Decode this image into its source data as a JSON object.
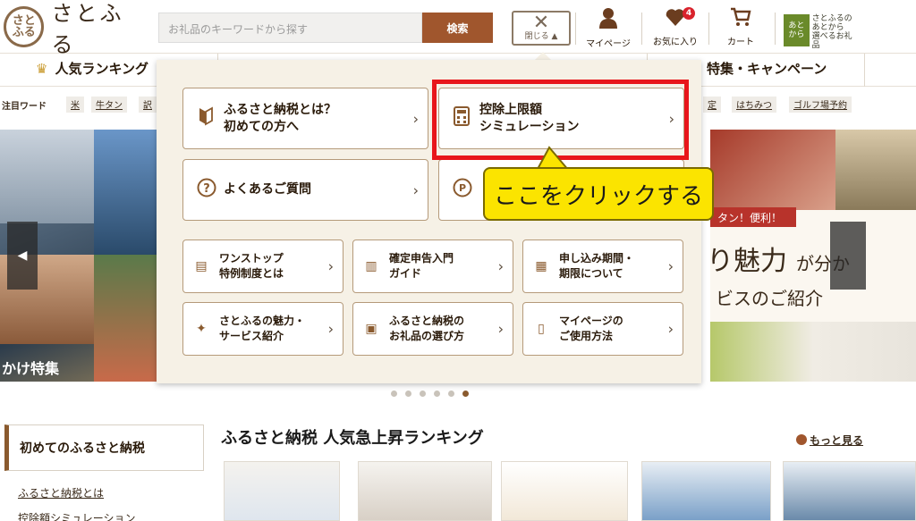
{
  "header": {
    "logo_mark": "さと\nふる",
    "logo_text": "さとふる",
    "search_placeholder": "お礼品のキーワードから探す",
    "search_button": "検索",
    "close_label": "閉じる ▲",
    "close_glyph": "✕",
    "mypage_label": "マイページ",
    "favorites_label": "お気に入り",
    "favorites_count": "4",
    "cart_label": "カート",
    "atokara_badge": "あと\nから",
    "atokara_text": "さとふるの\nあとから\n選べるお礼品"
  },
  "nav": {
    "ranking": "人気ランキング",
    "campaign": "特集・キャンペーン"
  },
  "keywords": {
    "label": "注目ワード",
    "items": [
      "米",
      "牛タン",
      "訳",
      "定",
      "はちみつ",
      "ゴルフ場予約"
    ]
  },
  "hero": {
    "left_caption": "かけ特集",
    "ribbon": "タン！便利！",
    "miryoku": "り魅力",
    "miryoku_suffix": "が分か",
    "service": "ビスのご紹介"
  },
  "menu": {
    "cards_large": [
      {
        "icon": "beginner-mark-icon",
        "glyph": "◆",
        "text": "ふるさと納税とは？\n初めての方へ"
      },
      {
        "icon": "calculator-icon",
        "glyph": "▦",
        "text": "控除上限額\nシミュレーション"
      },
      {
        "icon": "question-icon",
        "glyph": "?",
        "text": "よくあるご質問"
      },
      {
        "icon": "point-icon",
        "glyph": "P",
        "text": ""
      }
    ],
    "cards_small": [
      {
        "icon": "document-icon",
        "glyph": "▤",
        "text": "ワンストップ\n特例制度とは"
      },
      {
        "icon": "guide-book-icon",
        "glyph": "▥",
        "text": "確定申告入門\nガイド"
      },
      {
        "icon": "calendar-icon",
        "glyph": "▦",
        "text": "申し込み期間・\n期限について"
      },
      {
        "icon": "sparkle-icon",
        "glyph": "✦",
        "text": "さとふるの魅力・\nサービス紹介"
      },
      {
        "icon": "gift-icon",
        "glyph": "▣",
        "text": "ふるさと納税の\nお礼品の選び方"
      },
      {
        "icon": "phone-icon",
        "glyph": "▯",
        "text": "マイページの\nご使用方法"
      }
    ],
    "callout": "ここをクリックする"
  },
  "bottom": {
    "side_title": "初めてのふるさと納税",
    "side_links": [
      "ふるさと納税とは",
      "控除額シミュレーション"
    ],
    "ranking_title": "ふるさと納税 人気急上昇ランキング",
    "more": "もっと見る"
  },
  "colors": {
    "accent": "#a0562d",
    "highlight_frame": "#e8161b",
    "callout": "#fbe400",
    "menu_bg": "#f6f1e6"
  }
}
